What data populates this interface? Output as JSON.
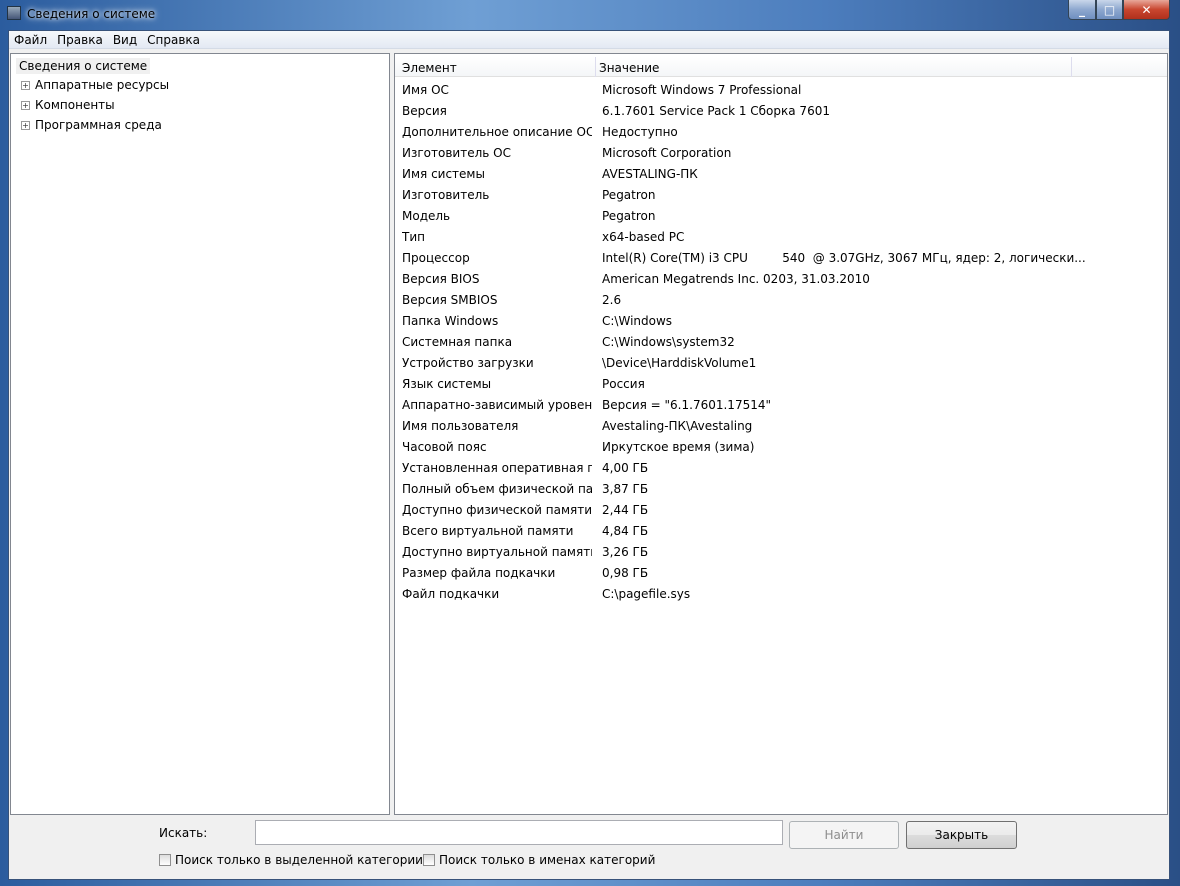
{
  "window": {
    "title": "Сведения о системе"
  },
  "menu": [
    "Файл",
    "Правка",
    "Вид",
    "Справка"
  ],
  "tree": {
    "root": "Сведения о системе",
    "items": [
      "Аппаратные ресурсы",
      "Компоненты",
      "Программная среда"
    ]
  },
  "table": {
    "headers": [
      "Элемент",
      "Значение"
    ],
    "rows": [
      [
        "Имя ОС",
        "Microsoft Windows 7 Professional"
      ],
      [
        "Версия",
        "6.1.7601 Service Pack 1 Сборка 7601"
      ],
      [
        "Дополнительное описание ОС",
        "Недоступно"
      ],
      [
        "Изготовитель ОС",
        "Microsoft Corporation"
      ],
      [
        "Имя системы",
        "AVESTALING-ПК"
      ],
      [
        "Изготовитель",
        "Pegatron"
      ],
      [
        "Модель",
        "Pegatron"
      ],
      [
        "Тип",
        "x64-based PC"
      ],
      [
        "Процессор",
        "Intel(R) Core(TM) i3 CPU         540  @ 3.07GHz, 3067 МГц, ядер: 2, логически..."
      ],
      [
        "Версия BIOS",
        "American Megatrends Inc. 0203, 31.03.2010"
      ],
      [
        "Версия SMBIOS",
        "2.6"
      ],
      [
        "Папка Windows",
        "C:\\Windows"
      ],
      [
        "Системная папка",
        "C:\\Windows\\system32"
      ],
      [
        "Устройство загрузки",
        "\\Device\\HarddiskVolume1"
      ],
      [
        "Язык системы",
        "Россия"
      ],
      [
        "Аппаратно-зависимый уровен...",
        "Версия = \"6.1.7601.17514\""
      ],
      [
        "Имя пользователя",
        "Avestaling-ПК\\Avestaling"
      ],
      [
        "Часовой пояс",
        "Иркутское время (зима)"
      ],
      [
        "Установленная оперативная п...",
        "4,00 ГБ"
      ],
      [
        "Полный объем физической па...",
        "3,87 ГБ"
      ],
      [
        "Доступно физической памяти",
        "2,44 ГБ"
      ],
      [
        "Всего виртуальной памяти",
        "4,84 ГБ"
      ],
      [
        "Доступно виртуальной памяти",
        "3,26 ГБ"
      ],
      [
        "Размер файла подкачки",
        "0,98 ГБ"
      ],
      [
        "Файл подкачки",
        "C:\\pagefile.sys"
      ]
    ]
  },
  "bottom": {
    "search_label": "Искать:",
    "search_value": "",
    "find": "Найти",
    "close": "Закрыть",
    "check1": "Поиск только в выделенной категории",
    "check2": "Поиск только в именах категорий"
  }
}
